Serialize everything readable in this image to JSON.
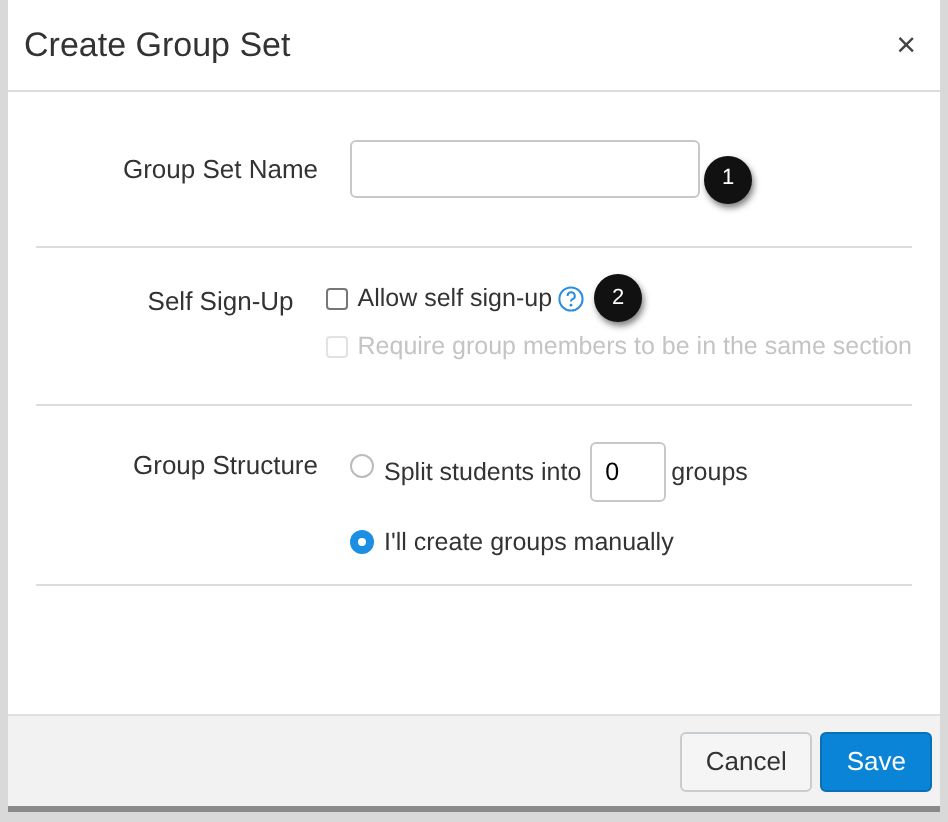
{
  "dialog": {
    "title": "Create Group Set",
    "close": "×"
  },
  "name_field": {
    "label": "Group Set Name",
    "callout": "1"
  },
  "self_signup": {
    "label": "Self Sign-Up",
    "options": [
      {
        "label": "Allow self sign-up",
        "checked": false,
        "disabled": false,
        "help": true,
        "callout": "2"
      },
      {
        "label": "Require group members to be in the same section",
        "checked": false,
        "disabled": true,
        "help": false
      }
    ]
  },
  "group_structure": {
    "label": "Group Structure",
    "options": [
      {
        "kind": "split",
        "before": "Split students into",
        "value": "0",
        "after": "groups",
        "selected": false
      },
      {
        "kind": "manual",
        "label": "I'll create groups manually",
        "selected": true
      }
    ]
  },
  "buttons": [
    {
      "label": "Cancel",
      "kind": "secondary"
    },
    {
      "label": "Save",
      "kind": "primary"
    }
  ]
}
